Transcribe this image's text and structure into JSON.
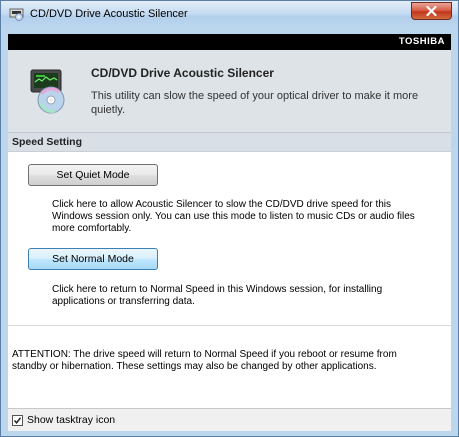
{
  "window": {
    "title": "CD/DVD Drive Acoustic Silencer",
    "brand": "TOSHIBA"
  },
  "header": {
    "title": "CD/DVD Drive Acoustic Silencer",
    "description": "This utility can slow  the speed of  your optical driver to make it more quietly."
  },
  "speed_setting": {
    "title": "Speed Setting",
    "quiet_button": "Set Quiet Mode",
    "quiet_description": "Click here to allow Acoustic Silencer to slow the CD/DVD drive speed for this Windows session only. You can use this mode to listen to music CDs or audio files more comfortably.",
    "normal_button": "Set Normal Mode",
    "normal_description": "Click here to return to Normal Speed in this Windows session, for installing applications or transferring data."
  },
  "attention": "ATTENTION: The drive speed will return to Normal Speed if you reboot or resume from standby or hibernation. These settings may also be changed by other applications.",
  "footer": {
    "tasktray_label": "Show tasktray icon",
    "tasktray_checked": true
  },
  "icons": {
    "app": "cd-drive-icon",
    "header": "cd-disc-monitor-icon",
    "close": "close-icon",
    "check": "check-icon"
  },
  "colors": {
    "brand_bar": "#000000",
    "close_button": "#c94a32",
    "header_bg": "#dde3e7",
    "section_bg": "#d8dfe6",
    "active_button": "#bee6fd"
  }
}
